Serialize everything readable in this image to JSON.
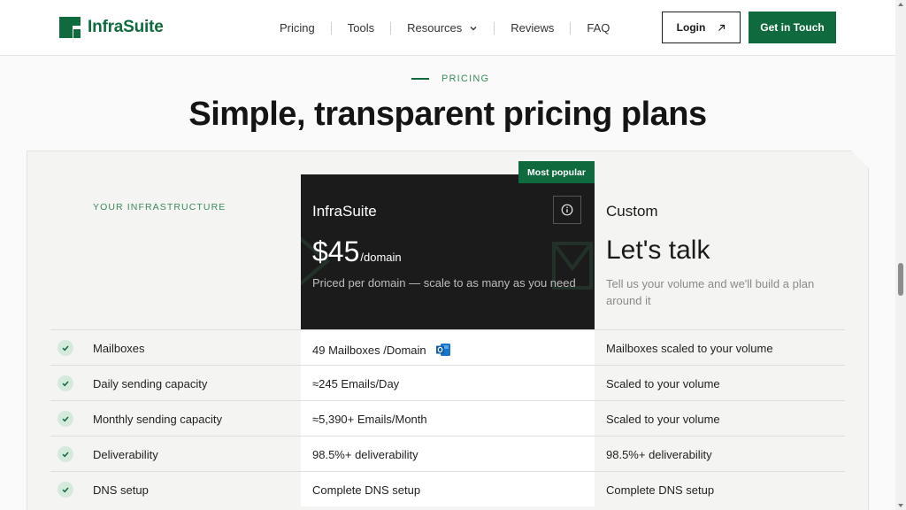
{
  "header": {
    "brand": "InfraSuite",
    "nav": [
      {
        "label": "Pricing"
      },
      {
        "label": "Tools"
      },
      {
        "label": "Resources"
      },
      {
        "label": "Reviews"
      },
      {
        "label": "FAQ"
      }
    ],
    "login_label": "Login",
    "cta_label": "Get in Touch"
  },
  "section": {
    "eyebrow": "PRICING",
    "title": "Simple, transparent pricing plans"
  },
  "table": {
    "infra_label": "YOUR INFRASTRUCTURE",
    "featured": {
      "badge": "Most popular",
      "name": "InfraSuite",
      "price": "$45",
      "unit": "/domain",
      "note": "Priced per domain — scale to as many as you need"
    },
    "custom": {
      "name": "Custom",
      "title": "Let's talk",
      "note": "Tell us your volume and we'll build a plan around it"
    },
    "rows": [
      {
        "feature": "Mailboxes",
        "value": "49 Mailboxes /Domain",
        "custom": "Mailboxes scaled to your volume"
      },
      {
        "feature": "Daily sending capacity",
        "value": "≈245 Emails/Day",
        "custom": "Scaled to your volume"
      },
      {
        "feature": "Monthly sending capacity",
        "value": "≈5,390+ Emails/Month",
        "custom": "Scaled to your volume"
      },
      {
        "feature": "Deliverability",
        "value": "98.5%+ deliverability",
        "custom": "98.5%+ deliverability"
      },
      {
        "feature": "DNS setup",
        "value": "Complete DNS setup",
        "custom": "Complete DNS setup"
      }
    ]
  },
  "colors": {
    "brand_green": "#0f6b3e",
    "dark_panel": "#1b1b1b",
    "check_bg": "#d6eadc"
  },
  "icons": {
    "logo": "infrasuite-logo-icon",
    "resources_chevron": "chevron-down-icon",
    "login_arrow": "arrow-up-right-icon",
    "info": "info-icon",
    "check": "check-icon",
    "outlook": "outlook-icon"
  }
}
